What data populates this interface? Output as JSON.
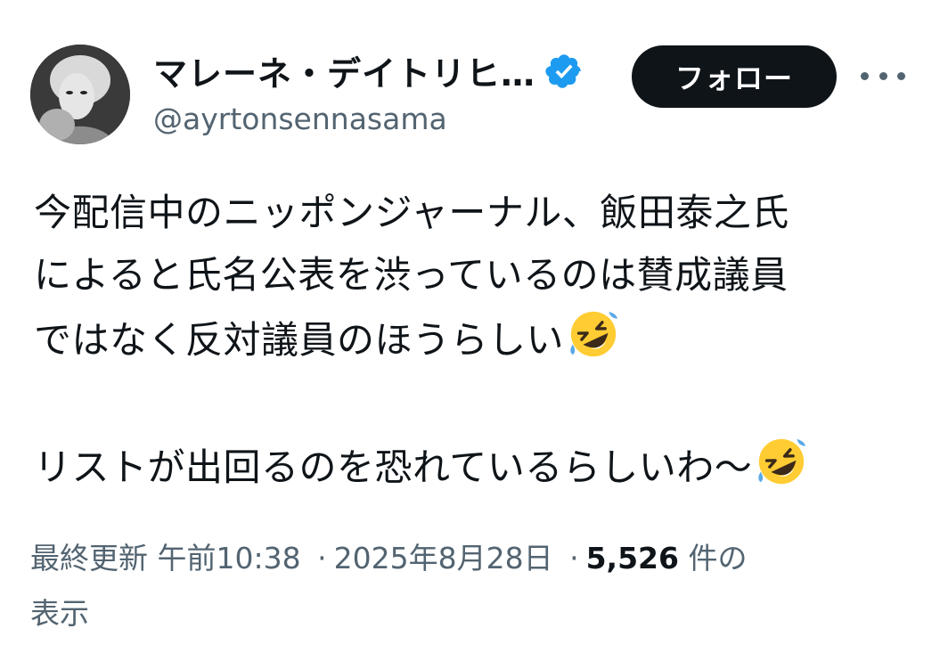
{
  "author": {
    "display_name": "マレーネ・デイトリヒ…",
    "handle": "@ayrtonsennasama",
    "verified": true
  },
  "actions": {
    "follow_label": "フォロー",
    "more_icon": "more-horizontal-icon"
  },
  "tweet": {
    "lines": [
      "今配信中のニッポンジャーナル、飯田泰之氏",
      "によると氏名公表を渋っているのは賛成議員",
      "ではなく反対議員のほうらしい"
    ],
    "line2": "リストが出回るのを恐れているらしいわ〜",
    "emoji": "rolling-on-floor-laughing-emoji"
  },
  "meta": {
    "edited_label": "最終更新",
    "time": "午前10:38",
    "separator": "·",
    "date": "2025年8月28日",
    "views_count": "5,526",
    "views_suffix": "件の",
    "views_label2": "表示"
  },
  "colors": {
    "text": "#0f1419",
    "secondary": "#536471",
    "verified_blue": "#1d9bf0",
    "button_bg": "#0f1419"
  }
}
